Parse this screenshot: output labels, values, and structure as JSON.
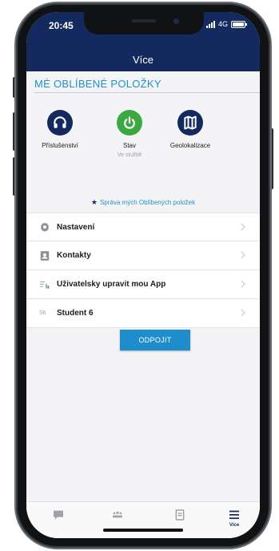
{
  "status_bar": {
    "time": "20:45",
    "network": "4G"
  },
  "header": {
    "title": "Více"
  },
  "favorites": {
    "heading": "MÉ OBLÍBENÉ POLOŽKY",
    "items": [
      {
        "label": "Příslušenství",
        "sublabel": "",
        "icon": "headphones-icon",
        "color": "#14295e"
      },
      {
        "label": "Stav",
        "sublabel": "Ve službě",
        "icon": "power-icon",
        "color": "#3aa942"
      },
      {
        "label": "Geolokalizace",
        "sublabel": "",
        "icon": "map-icon",
        "color": "#14295e"
      }
    ],
    "manage_link": "Správa mých Oblíbených položek"
  },
  "menu": {
    "items": [
      {
        "label": "Nastavení",
        "icon": "gear-icon"
      },
      {
        "label": "Kontakty",
        "icon": "contacts-icon"
      },
      {
        "label": "Uživatelsky upravit mou App",
        "icon": "customize-icon"
      },
      {
        "label": "Student 6",
        "icon_text": "S6"
      }
    ]
  },
  "disconnect_button": "ODPOJIT",
  "tabbar": {
    "tabs": [
      {
        "icon": "chat-icon",
        "label": ""
      },
      {
        "icon": "group-icon",
        "label": ""
      },
      {
        "icon": "contacts-icon",
        "label": ""
      },
      {
        "icon": "menu-icon",
        "label": "Více",
        "active": true
      }
    ]
  },
  "colors": {
    "primary": "#14295e",
    "accent": "#1b93c9",
    "status_green": "#3aa942",
    "button": "#1f8ccc"
  }
}
